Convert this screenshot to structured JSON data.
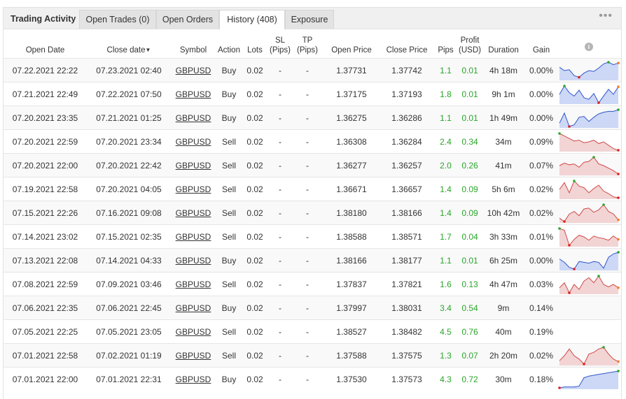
{
  "tabs": {
    "title": "Trading Activity",
    "open_trades": "Open Trades (0)",
    "open_orders": "Open Orders",
    "history": "History (408)",
    "exposure": "Exposure"
  },
  "more_label": "•••",
  "columns": {
    "open_date": "Open Date",
    "close_date": "Close date",
    "symbol": "Symbol",
    "action": "Action",
    "lots": "Lots",
    "sl": "SL",
    "sl_unit": "(Pips)",
    "tp": "TP",
    "tp_unit": "(Pips)",
    "open_price": "Open Price",
    "close_price": "Close Price",
    "pips": "Pips",
    "profit": "Profit",
    "profit_unit": "(USD)",
    "duration": "Duration",
    "gain": "Gain",
    "info_icon": "i"
  },
  "colors": {
    "green": "#2aa52a",
    "buy_line": "#2f56c9",
    "buy_fill": "#cdd8f6",
    "sell_line": "#d14848",
    "sell_fill": "#f2d4d4",
    "marker_high": "#2aa52a",
    "marker_low": "#e02020",
    "marker_end": "#f08030"
  },
  "rows": [
    {
      "open": "07.22.2021 22:22",
      "close": "07.23.2021 02:40",
      "symbol": "GBPUSD",
      "action": "Buy",
      "lots": "0.02",
      "sl": "-",
      "tp": "-",
      "open_price": "1.37731",
      "close_price": "1.37742",
      "pips": "1.1",
      "profit": "0.01",
      "duration": "4h 18m",
      "gain": "0.00%",
      "spark": {
        "type": "buy",
        "values": [
          0.7,
          0.5,
          0.55,
          0.2,
          0.1,
          0.35,
          0.5,
          0.45,
          0.65,
          0.9,
          1.0,
          0.85,
          0.95
        ]
      }
    },
    {
      "open": "07.21.2021 22:49",
      "close": "07.22.2021 07:50",
      "symbol": "GBPUSD",
      "action": "Buy",
      "lots": "0.02",
      "sl": "-",
      "tp": "-",
      "open_price": "1.37175",
      "close_price": "1.37193",
      "pips": "1.8",
      "profit": "0.01",
      "duration": "9h 1m",
      "gain": "0.00%",
      "spark": {
        "type": "buy",
        "values": [
          0.5,
          1.0,
          0.6,
          0.4,
          0.75,
          0.3,
          0.2,
          0.55,
          0.0,
          0.4,
          0.8,
          0.5,
          0.95
        ]
      }
    },
    {
      "open": "07.20.2021 23:35",
      "close": "07.21.2021 01:25",
      "symbol": "GBPUSD",
      "action": "Buy",
      "lots": "0.02",
      "sl": "-",
      "tp": "-",
      "open_price": "1.36275",
      "close_price": "1.36286",
      "pips": "1.1",
      "profit": "0.01",
      "duration": "1h 49m",
      "gain": "0.00%",
      "spark": {
        "type": "buy",
        "values": [
          0.2,
          0.8,
          0.0,
          0.1,
          0.55,
          0.6,
          0.3,
          0.55,
          0.75,
          0.85,
          0.9,
          0.9,
          1.0
        ]
      }
    },
    {
      "open": "07.20.2021 22:59",
      "close": "07.20.2021 23:34",
      "symbol": "GBPUSD",
      "action": "Sell",
      "lots": "0.02",
      "sl": "-",
      "tp": "-",
      "open_price": "1.36308",
      "close_price": "1.36284",
      "pips": "2.4",
      "profit": "0.34",
      "duration": "34m",
      "gain": "0.09%",
      "spark": {
        "type": "sell",
        "values": [
          1.0,
          0.85,
          0.7,
          0.55,
          0.6,
          0.45,
          0.5,
          0.6,
          0.4,
          0.5,
          0.3,
          0.1,
          0.0
        ]
      }
    },
    {
      "open": "07.20.2021 22:00",
      "close": "07.20.2021 22:42",
      "symbol": "GBPUSD",
      "action": "Sell",
      "lots": "0.02",
      "sl": "-",
      "tp": "-",
      "open_price": "1.36277",
      "close_price": "1.36257",
      "pips": "2.0",
      "profit": "0.26",
      "duration": "41m",
      "gain": "0.07%",
      "spark": {
        "type": "sell",
        "values": [
          0.5,
          0.65,
          0.55,
          0.6,
          0.4,
          0.7,
          0.75,
          1.0,
          0.6,
          0.5,
          0.35,
          0.2,
          0.0
        ]
      }
    },
    {
      "open": "07.19.2021 22:58",
      "close": "07.20.2021 04:05",
      "symbol": "GBPUSD",
      "action": "Sell",
      "lots": "0.02",
      "sl": "-",
      "tp": "-",
      "open_price": "1.36671",
      "close_price": "1.36657",
      "pips": "1.4",
      "profit": "0.09",
      "duration": "5h 6m",
      "gain": "0.02%",
      "spark": {
        "type": "sell",
        "values": [
          0.5,
          0.9,
          0.3,
          1.0,
          0.7,
          0.6,
          0.3,
          0.55,
          0.75,
          0.4,
          0.25,
          0.05,
          0.0
        ]
      }
    },
    {
      "open": "07.15.2021 22:26",
      "close": "07.16.2021 09:08",
      "symbol": "GBPUSD",
      "action": "Sell",
      "lots": "0.02",
      "sl": "-",
      "tp": "-",
      "open_price": "1.38180",
      "close_price": "1.38166",
      "pips": "1.4",
      "profit": "0.09",
      "duration": "10h 42m",
      "gain": "0.02%",
      "spark": {
        "type": "sell",
        "values": [
          0.2,
          0.0,
          0.45,
          0.6,
          0.35,
          0.75,
          0.8,
          0.55,
          0.7,
          1.0,
          0.6,
          0.45,
          0.1
        ]
      }
    },
    {
      "open": "07.14.2021 23:02",
      "close": "07.15.2021 02:35",
      "symbol": "GBPUSD",
      "action": "Sell",
      "lots": "0.02",
      "sl": "-",
      "tp": "-",
      "open_price": "1.38588",
      "close_price": "1.38571",
      "pips": "1.7",
      "profit": "0.04",
      "duration": "3h 33m",
      "gain": "0.01%",
      "spark": {
        "type": "sell",
        "values": [
          1.0,
          0.9,
          0.0,
          0.35,
          0.6,
          0.5,
          0.3,
          0.55,
          0.45,
          0.4,
          0.3,
          0.55,
          0.35
        ]
      }
    },
    {
      "open": "07.13.2021 22:08",
      "close": "07.14.2021 04:33",
      "symbol": "GBPUSD",
      "action": "Buy",
      "lots": "0.02",
      "sl": "-",
      "tp": "-",
      "open_price": "1.38166",
      "close_price": "1.38177",
      "pips": "1.1",
      "profit": "0.01",
      "duration": "6h 25m",
      "gain": "0.00%",
      "spark": {
        "type": "buy",
        "values": [
          0.6,
          0.4,
          0.1,
          0.0,
          0.45,
          0.4,
          0.35,
          0.45,
          0.4,
          0.05,
          0.7,
          0.9,
          1.0
        ]
      }
    },
    {
      "open": "07.08.2021 22:59",
      "close": "07.09.2021 03:46",
      "symbol": "GBPUSD",
      "action": "Sell",
      "lots": "0.02",
      "sl": "-",
      "tp": "-",
      "open_price": "1.37837",
      "close_price": "1.37821",
      "pips": "1.6",
      "profit": "0.13",
      "duration": "4h 47m",
      "gain": "0.03%",
      "spark": {
        "type": "sell",
        "values": [
          0.3,
          0.6,
          0.0,
          0.5,
          0.2,
          0.7,
          0.9,
          0.6,
          1.0,
          0.5,
          0.35,
          0.5,
          0.3
        ]
      }
    },
    {
      "open": "07.06.2021 22:35",
      "close": "07.06.2021 22:45",
      "symbol": "GBPUSD",
      "action": "Buy",
      "lots": "0.02",
      "sl": "-",
      "tp": "-",
      "open_price": "1.37997",
      "close_price": "1.38031",
      "pips": "3.4",
      "profit": "0.54",
      "duration": "9m",
      "gain": "0.14%",
      "spark": null
    },
    {
      "open": "07.05.2021 22:25",
      "close": "07.05.2021 23:05",
      "symbol": "GBPUSD",
      "action": "Sell",
      "lots": "0.02",
      "sl": "-",
      "tp": "-",
      "open_price": "1.38527",
      "close_price": "1.38482",
      "pips": "4.5",
      "profit": "0.76",
      "duration": "40m",
      "gain": "0.19%",
      "spark": null
    },
    {
      "open": "07.01.2021 22:58",
      "close": "07.02.2021 01:19",
      "symbol": "GBPUSD",
      "action": "Sell",
      "lots": "0.02",
      "sl": "-",
      "tp": "-",
      "open_price": "1.37588",
      "close_price": "1.37575",
      "pips": "1.3",
      "profit": "0.07",
      "duration": "2h 20m",
      "gain": "0.02%",
      "spark": {
        "type": "sell",
        "values": [
          0.2,
          0.5,
          0.9,
          0.5,
          0.3,
          0.0,
          0.6,
          0.7,
          0.9,
          1.0,
          0.6,
          0.3,
          0.15
        ]
      }
    },
    {
      "open": "07.01.2021 22:00",
      "close": "07.01.2021 22:31",
      "symbol": "GBPUSD",
      "action": "Buy",
      "lots": "0.02",
      "sl": "-",
      "tp": "-",
      "open_price": "1.37530",
      "close_price": "1.37573",
      "pips": "4.3",
      "profit": "0.72",
      "duration": "30m",
      "gain": "0.18%",
      "spark": {
        "type": "buy",
        "values": [
          0.0,
          0.05,
          0.05,
          0.05,
          0.1,
          0.6,
          0.7,
          0.75,
          0.8,
          0.85,
          0.9,
          0.95,
          1.0
        ]
      }
    }
  ]
}
